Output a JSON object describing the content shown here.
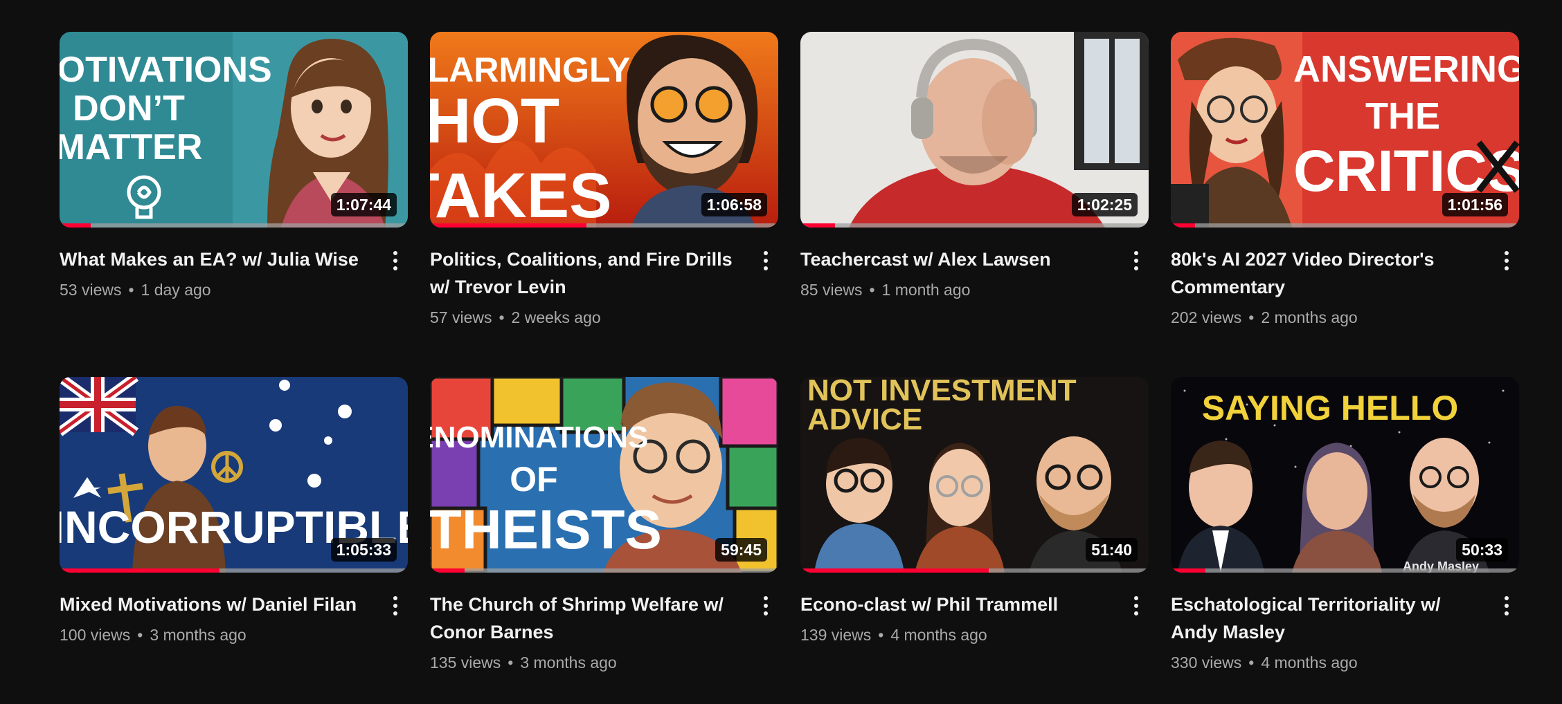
{
  "videos": [
    {
      "title": "What Makes an EA? w/ Julia Wise",
      "views": "53 views",
      "age": "1 day ago",
      "duration": "1:07:44",
      "progress": 0.09,
      "thumb_text": [
        "MOTIVATIONS",
        "DON’T",
        "MATTER"
      ]
    },
    {
      "title": "Politics, Coalitions, and Fire Drills w/ Trevor Levin",
      "views": "57 views",
      "age": "2 weeks ago",
      "duration": "1:06:58",
      "progress": 0.45,
      "thumb_text": [
        "ALARMINGLY",
        "HOT",
        "TAKES"
      ]
    },
    {
      "title": "Teachercast w/ Alex Lawsen",
      "views": "85 views",
      "age": "1 month ago",
      "duration": "1:02:25",
      "progress": 0.1,
      "thumb_text": []
    },
    {
      "title": "80k's AI 2027 Video Director's Commentary",
      "views": "202 views",
      "age": "2 months ago",
      "duration": "1:01:56",
      "progress": 0.07,
      "thumb_text": [
        "ANSWERING",
        "THE",
        "CRITICS"
      ]
    },
    {
      "title": "Mixed Motivations w/ Daniel Filan",
      "views": "100 views",
      "age": "3 months ago",
      "duration": "1:05:33",
      "progress": 0.46,
      "thumb_text": [
        "INCORRUPTIBLE"
      ]
    },
    {
      "title": "The Church of Shrimp Welfare w/ Conor Barnes",
      "views": "135 views",
      "age": "3 months ago",
      "duration": "59:45",
      "progress": 0.1,
      "thumb_text": [
        "DENOMINATIONS",
        "OF",
        "ATHEISTS"
      ]
    },
    {
      "title": "Econo-clast w/ Phil Trammell",
      "views": "139 views",
      "age": "4 months ago",
      "duration": "51:40",
      "progress": 0.54,
      "thumb_text": [
        "NOT INVESTMENT",
        "ADVICE"
      ]
    },
    {
      "title": "Eschatological Territoriality w/ Andy Masley",
      "views": "330 views",
      "age": "4 months ago",
      "duration": "50:33",
      "progress": 0.1,
      "thumb_text": [
        "SAYING HELLO",
        "Andy Masley"
      ]
    }
  ],
  "colors": {
    "background": "#0f0f0f",
    "progress": "#ff0033",
    "meta_text": "#aaaaaa"
  },
  "icons": {
    "more": "vertical-dots-icon"
  }
}
